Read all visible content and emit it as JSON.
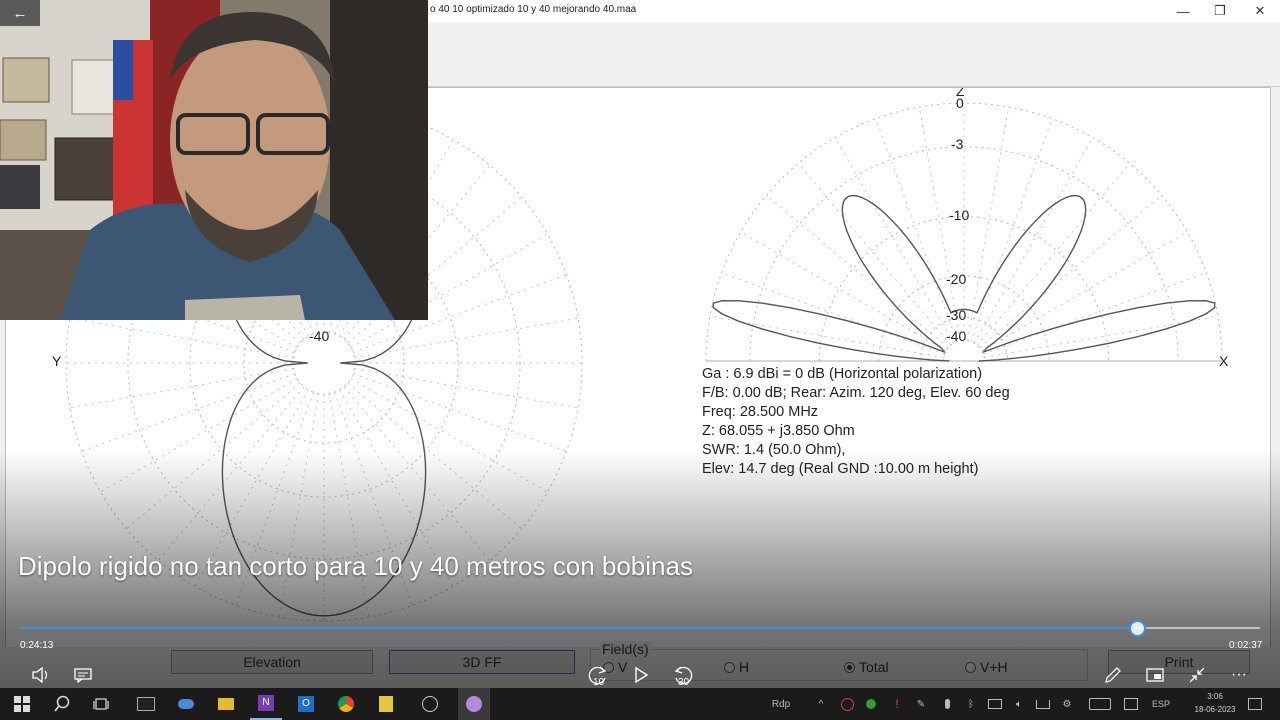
{
  "window": {
    "title": "o 40 10 optimizado 10 y 40 mejorando 40.maa",
    "minimize": "—",
    "maximize": "❐",
    "close": "✕"
  },
  "plot": {
    "azimuth": {
      "axis_left": "Y",
      "ring_label": "-40"
    },
    "elevation": {
      "axis_top": "Z",
      "axis_right": "X",
      "ring_labels": [
        "0",
        "-3",
        "-10",
        "-20",
        "-30",
        "-40"
      ]
    },
    "info": {
      "line1": "Ga : 6.9 dBi = 0 dB  (Horizontal polarization)",
      "line2": "F/B: 0.00 dB; Rear: Azim. 120 deg,  Elev. 60 deg",
      "line3": "Freq: 28.500 MHz",
      "line4": "Z: 68.055 + j3.850 Ohm",
      "line5": "SWR: 1.4 (50.0 Ohm),",
      "line6": "Elev: 14.7 deg (Real GND  :10.00 m height)"
    }
  },
  "controls": {
    "elevation_button": "Elevation",
    "ff3d_button": "3D FF",
    "field_label": "Field(s)",
    "radios": [
      {
        "label": "V",
        "selected": false
      },
      {
        "label": "H",
        "selected": false
      },
      {
        "label": "Total",
        "selected": true
      },
      {
        "label": "V+H",
        "selected": false
      }
    ],
    "print_button": "Print"
  },
  "player": {
    "video_title": "Dipolo rigido no tan corto para 10 y 40 metros con bobinas",
    "elapsed": "0:24:13",
    "remaining": "0:02:37",
    "progress": 0.9,
    "skip_back_seconds": "10",
    "skip_forward_seconds": "30",
    "back_icon": "arrow-left-icon",
    "accent": "#3d8ee0"
  },
  "taskbar": {
    "tray_rdp": "Rdp",
    "language": "ESP",
    "clock_time": "3:06",
    "clock_date": "18-06-2023"
  }
}
